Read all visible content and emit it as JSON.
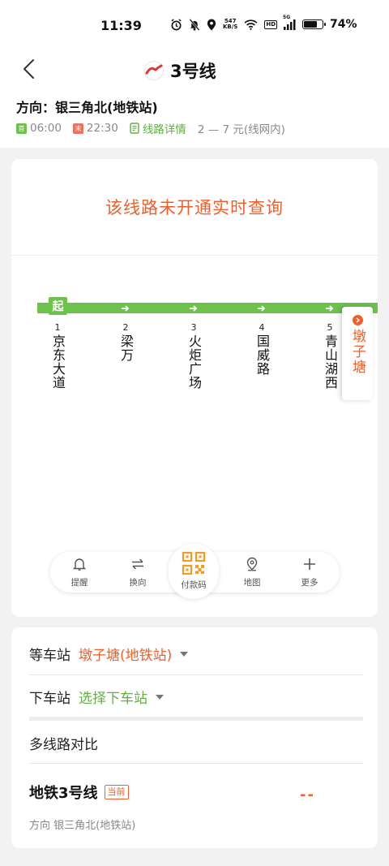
{
  "status_bar": {
    "time": "11:39",
    "net_speed_value": "547",
    "net_speed_unit": "KB/S",
    "hd": "HD",
    "signal_label": "5G",
    "battery": "74%",
    "battery_level": 0.74
  },
  "header": {
    "title": "3号线",
    "direction": "方向：银三角北(地铁站)",
    "first_badge": "首",
    "first_time": "06:00",
    "last_badge": "末",
    "last_time": "22:30",
    "detail_link": "线路详情",
    "fare": "2 — 7 元(线网内)"
  },
  "notice": "该线路未开通实时查询",
  "stations": [
    {
      "num": "1",
      "name": "京东大道"
    },
    {
      "num": "2",
      "name": "梁万"
    },
    {
      "num": "3",
      "name": "火炬广场"
    },
    {
      "num": "4",
      "name": "国威路"
    },
    {
      "num": "5",
      "name": "青山湖西"
    }
  ],
  "start_label": "起",
  "current_station": "墩子塘",
  "toolbar": {
    "remind": "提醒",
    "switch": "换向",
    "pay": "付款码",
    "map": "地图",
    "more": "更多"
  },
  "boarding": {
    "wait_label": "等车站",
    "wait_value": "墩子塘(地铁站)",
    "alight_label": "下车站",
    "alight_value": "选择下车站"
  },
  "compare": "多线路对比",
  "metro": {
    "name": "地铁3号线",
    "badge": "当前",
    "eta": "--",
    "direction": "方向 银三角北(地铁站)"
  },
  "colors": {
    "accent_orange": "#f0602a",
    "accent_green": "#6cc24a"
  }
}
